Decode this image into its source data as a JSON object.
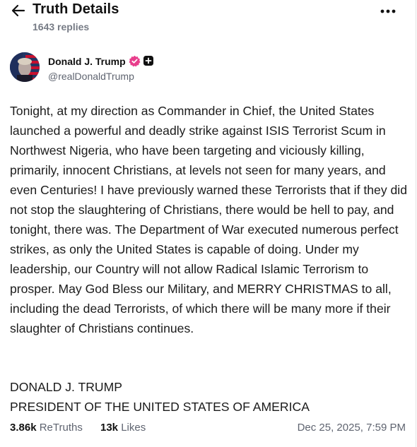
{
  "header": {
    "title": "Truth Details",
    "replies": "1643 replies"
  },
  "author": {
    "name": "Donald J. Trump",
    "handle": "@realDonaldTrump"
  },
  "post": {
    "body": "Tonight, at my direction as Commander in Chief, the United States launched a powerful and deadly strike against ISIS Terrorist Scum in Northwest Nigeria, who have been targeting and viciously killing, primarily, innocent Christians, at levels not seen for many years, and even Centuries! I have previously warned these Terrorists that if they did not stop the slaughtering of Christians, there would be hell to pay, and tonight, there was. The Department of War executed numerous perfect strikes, as only the United States is capable of doing. Under my leadership, our Country will not allow Radical Islamic Terrorism to prosper. May God Bless our Military, and MERRY CHRISTMAS to all, including the dead Terrorists, of which there will be many more if their slaughter of Christians continues.",
    "signature_line1": "DONALD J. TRUMP",
    "signature_line2": "PRESIDENT OF THE UNITED STATES OF AMERICA"
  },
  "stats": {
    "retruths_count": "3.86k",
    "retruths_label": "ReTruths",
    "likes_count": "13k",
    "likes_label": "Likes",
    "timestamp": "Dec 25, 2025, 7:59 PM"
  },
  "colors": {
    "verified_badge": "#e83e8c",
    "text_primary": "#111111",
    "text_secondary": "#5f6470"
  },
  "icons": {
    "back": "arrow-left-icon",
    "more": "more-horizontal-icon",
    "verified": "verified-badge-icon",
    "plus": "plus-badge-icon"
  }
}
